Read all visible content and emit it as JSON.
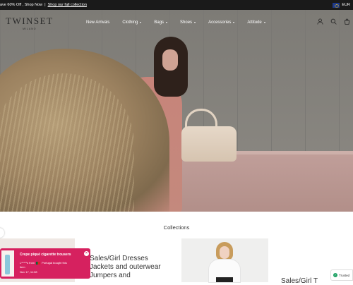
{
  "announcement": {
    "promo": "ave 60% Off , Shop Now",
    "separator": "|",
    "link": "Shop our fall collection",
    "currency": "EUR"
  },
  "brand": {
    "name": "TWINSET",
    "subline": "MILANO"
  },
  "nav": {
    "items": [
      {
        "label": "New Arrivals",
        "has_dropdown": false
      },
      {
        "label": "Clothing",
        "has_dropdown": true
      },
      {
        "label": "Bags",
        "has_dropdown": true
      },
      {
        "label": "Shoes",
        "has_dropdown": true
      },
      {
        "label": "Accessories",
        "has_dropdown": true
      },
      {
        "label": "Attitude",
        "has_dropdown": true
      }
    ],
    "icons": [
      "account-icon",
      "search-icon",
      "cart-icon"
    ]
  },
  "hero": {
    "slide_count": 2,
    "active_slide": 1
  },
  "collections": {
    "title": "Collections",
    "card1_lines": [
      "Sales/Girl Dresses",
      "Jackets and outerwear",
      "Jumpers and"
    ],
    "card2_text": "Sales/Girl T"
  },
  "toast": {
    "title": "Crepe piqué cigarette trousers",
    "buyer": "L*****s from",
    "buyer_suffix": "Portugal bought this",
    "buyer_line2": "item",
    "time": "Nov 17, 11:08",
    "close": "×"
  },
  "trusted": {
    "label": "Trusted"
  },
  "colors": {
    "toast": "#d6215f",
    "announcement_bg": "#1a1a1a",
    "trusted_check": "#21a366"
  }
}
